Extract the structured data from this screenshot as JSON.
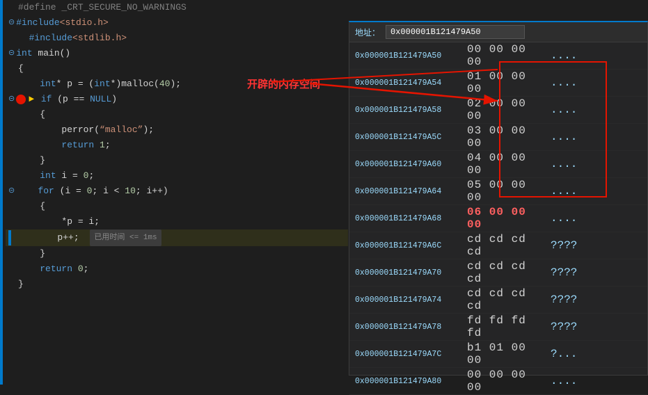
{
  "editor": {
    "leftbar_color": "#007acc",
    "lines": [
      {
        "id": "define-line",
        "fold": null,
        "breakpoint": false,
        "arrow": false,
        "content": "#define _CRT_SECURE_NO_WARNINGS",
        "type": "comment"
      },
      {
        "id": "include-stdio",
        "fold": "minus",
        "breakpoint": false,
        "arrow": false,
        "content_parts": [
          {
            "text": "#include",
            "cls": "kw-blue"
          },
          {
            "text": "<stdio.h>",
            "cls": "kw-string"
          }
        ]
      },
      {
        "id": "include-stdlib",
        "fold": null,
        "breakpoint": false,
        "arrow": false,
        "content_parts": [
          {
            "text": "  #include",
            "cls": "kw-blue"
          },
          {
            "text": "<stdlib.h>",
            "cls": "kw-string"
          }
        ]
      },
      {
        "id": "main-decl",
        "fold": "minus",
        "breakpoint": false,
        "arrow": false,
        "content_parts": [
          {
            "text": "int",
            "cls": "kw-blue"
          },
          {
            "text": " main()",
            "cls": "kw-white"
          }
        ]
      },
      {
        "id": "brace-open-1",
        "fold": null,
        "breakpoint": false,
        "arrow": false,
        "content": "{"
      },
      {
        "id": "int-p-decl",
        "fold": null,
        "breakpoint": false,
        "arrow": false,
        "content_parts": [
          {
            "text": "    int",
            "cls": "kw-blue"
          },
          {
            "text": "* p = (",
            "cls": "kw-white"
          },
          {
            "text": "int",
            "cls": "kw-blue"
          },
          {
            "text": "*)malloc(",
            "cls": "kw-white"
          },
          {
            "text": "40",
            "cls": "kw-number"
          },
          {
            "text": ");",
            "cls": "kw-white"
          }
        ]
      },
      {
        "id": "if-null-fold",
        "fold": "minus",
        "breakpoint": true,
        "arrow": true,
        "content_parts": [
          {
            "text": "    if (p == ",
            "cls": "kw-white"
          },
          {
            "text": "NULL",
            "cls": "kw-null"
          },
          {
            "text": ")",
            "cls": "kw-white"
          }
        ]
      },
      {
        "id": "brace-open-2",
        "fold": null,
        "breakpoint": false,
        "arrow": false,
        "content": "    {"
      },
      {
        "id": "perror-call",
        "fold": null,
        "breakpoint": false,
        "arrow": false,
        "content_parts": [
          {
            "text": "        perror(",
            "cls": "kw-white"
          },
          {
            "text": "“malloc”",
            "cls": "kw-string"
          },
          {
            "text": ");",
            "cls": "kw-white"
          }
        ]
      },
      {
        "id": "return-1",
        "fold": null,
        "breakpoint": false,
        "arrow": false,
        "content_parts": [
          {
            "text": "        return ",
            "cls": "kw-blue"
          },
          {
            "text": "1",
            "cls": "kw-number"
          },
          {
            "text": ";",
            "cls": "kw-white"
          }
        ]
      },
      {
        "id": "brace-close-2",
        "fold": null,
        "breakpoint": false,
        "arrow": false,
        "content": "    }"
      },
      {
        "id": "int-i",
        "fold": null,
        "breakpoint": false,
        "arrow": false,
        "content_parts": [
          {
            "text": "    int ",
            "cls": "kw-blue"
          },
          {
            "text": "i = ",
            "cls": "kw-white"
          },
          {
            "text": "0",
            "cls": "kw-number"
          },
          {
            "text": ";",
            "cls": "kw-white"
          }
        ]
      },
      {
        "id": "for-loop",
        "fold": "minus",
        "breakpoint": false,
        "arrow": false,
        "content_parts": [
          {
            "text": "    for (i = ",
            "cls": "kw-blue"
          },
          {
            "text": "0",
            "cls": "kw-number"
          },
          {
            "text": "; i < ",
            "cls": "kw-white"
          },
          {
            "text": "10",
            "cls": "kw-number"
          },
          {
            "text": "; i++)",
            "cls": "kw-white"
          }
        ]
      },
      {
        "id": "brace-open-3",
        "fold": null,
        "breakpoint": false,
        "arrow": false,
        "content": "    {"
      },
      {
        "id": "star-p",
        "fold": null,
        "breakpoint": false,
        "arrow": false,
        "content_parts": [
          {
            "text": "        *p = i;",
            "cls": "kw-white"
          }
        ]
      },
      {
        "id": "p-plus",
        "fold": null,
        "breakpoint": false,
        "arrow": false,
        "is_current": true,
        "content_parts": [
          {
            "text": "        p++;",
            "cls": "kw-white"
          }
        ],
        "time": "已用时间 <= 1ms"
      },
      {
        "id": "brace-close-3",
        "fold": null,
        "breakpoint": false,
        "arrow": false,
        "content": "    }"
      },
      {
        "id": "return-0",
        "fold": null,
        "breakpoint": false,
        "arrow": false,
        "content_parts": [
          {
            "text": "    return ",
            "cls": "kw-blue"
          },
          {
            "text": "0",
            "cls": "kw-number"
          },
          {
            "text": ";",
            "cls": "kw-white"
          }
        ]
      },
      {
        "id": "brace-close-main",
        "fold": null,
        "breakpoint": false,
        "arrow": false,
        "content": "}"
      }
    ]
  },
  "memory": {
    "title": "地址：",
    "address": "0x000001B121479A50",
    "rows": [
      {
        "addr": "0x000001B121479A50",
        "bytes": "00 00 00 00",
        "ascii": "....",
        "highlight": true
      },
      {
        "addr": "0x000001B121479A54",
        "bytes": "01 00 00 00",
        "ascii": "....",
        "highlight": true
      },
      {
        "addr": "0x000001B121479A58",
        "bytes": "02 00 00 00",
        "ascii": "....",
        "highlight": true
      },
      {
        "addr": "0x000001B121479A5C",
        "bytes": "03 00 00 00",
        "ascii": "....",
        "highlight": true
      },
      {
        "addr": "0x000001B121479A60",
        "bytes": "04 00 00 00",
        "ascii": "....",
        "highlight": true
      },
      {
        "addr": "0x000001B121479A64",
        "bytes": "05 00 00 00",
        "ascii": "....",
        "highlight": true
      },
      {
        "addr": "0x000001B121479A68",
        "bytes": "06 00 00 00",
        "ascii": "....",
        "highlight": true,
        "last_highlight": true
      },
      {
        "addr": "0x000001B121479A6C",
        "bytes": "cd cd cd cd",
        "ascii": "????",
        "highlight": false
      },
      {
        "addr": "0x000001B121479A70",
        "bytes": "cd cd cd cd",
        "ascii": "????",
        "highlight": false
      },
      {
        "addr": "0x000001B121479A74",
        "bytes": "cd cd cd cd",
        "ascii": "????",
        "highlight": false
      },
      {
        "addr": "0x000001B121479A78",
        "bytes": "fd fd fd fd",
        "ascii": "????",
        "highlight": false
      },
      {
        "addr": "0x000001B121479A7C",
        "bytes": "b1 01 00 00",
        "ascii": "?...",
        "highlight": false
      },
      {
        "addr": "0x000001B121479A80",
        "bytes": "00 00 00 00",
        "ascii": "....",
        "highlight": false
      }
    ]
  },
  "annotation": {
    "text": "开辟的内存空间"
  }
}
